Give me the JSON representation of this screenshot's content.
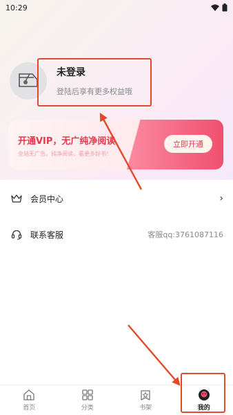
{
  "status_bar": {
    "time": "10:29"
  },
  "profile": {
    "title": "未登录",
    "subtitle": "登陆后享有更多权益哦"
  },
  "vip_card": {
    "title": "开通VIP，无广纯净阅读",
    "subtitle": "全站无广告，纯净阅读，看更多好书！",
    "button": "立即开通"
  },
  "menu": [
    {
      "label": "会员中心",
      "value": "",
      "icon": "crown-icon"
    },
    {
      "label": "联系客服",
      "value": "客服qq:3761087116",
      "icon": "headset-icon"
    }
  ],
  "bottom_nav": [
    {
      "label": "首页",
      "icon": "home-icon",
      "active": false
    },
    {
      "label": "分类",
      "icon": "grid-icon",
      "active": false
    },
    {
      "label": "书架",
      "icon": "bookshelf-icon",
      "active": false
    },
    {
      "label": "我的",
      "icon": "profile-icon",
      "active": true
    }
  ],
  "colors": {
    "accent": "#e23b4d",
    "annotation": "#e2492a"
  }
}
